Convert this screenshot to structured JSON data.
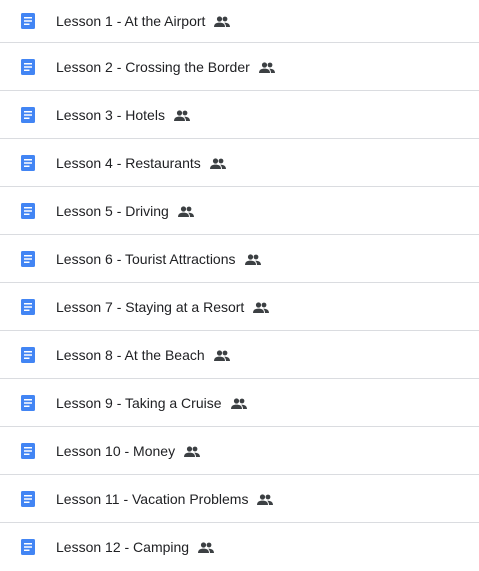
{
  "colors": {
    "doc_icon": "#4285f4",
    "text": "#202124",
    "shared_icon": "#3c4043",
    "divider": "#dadce0"
  },
  "icons": {
    "file": "google-docs-icon",
    "shared": "people-icon"
  },
  "files": [
    {
      "name": "Lesson 1 - At the Airport",
      "shared": true
    },
    {
      "name": "Lesson 2 - Crossing the Border",
      "shared": true
    },
    {
      "name": "Lesson 3 - Hotels",
      "shared": true
    },
    {
      "name": "Lesson 4 - Restaurants",
      "shared": true
    },
    {
      "name": "Lesson 5 - Driving",
      "shared": true
    },
    {
      "name": "Lesson 6 - Tourist Attractions",
      "shared": true
    },
    {
      "name": "Lesson 7 - Staying at a Resort",
      "shared": true
    },
    {
      "name": "Lesson 8 - At the Beach",
      "shared": true
    },
    {
      "name": "Lesson 9 - Taking a Cruise",
      "shared": true
    },
    {
      "name": "Lesson 10 - Money",
      "shared": true
    },
    {
      "name": "Lesson 11 - Vacation Problems",
      "shared": true
    },
    {
      "name": "Lesson 12 - Camping",
      "shared": true
    }
  ]
}
